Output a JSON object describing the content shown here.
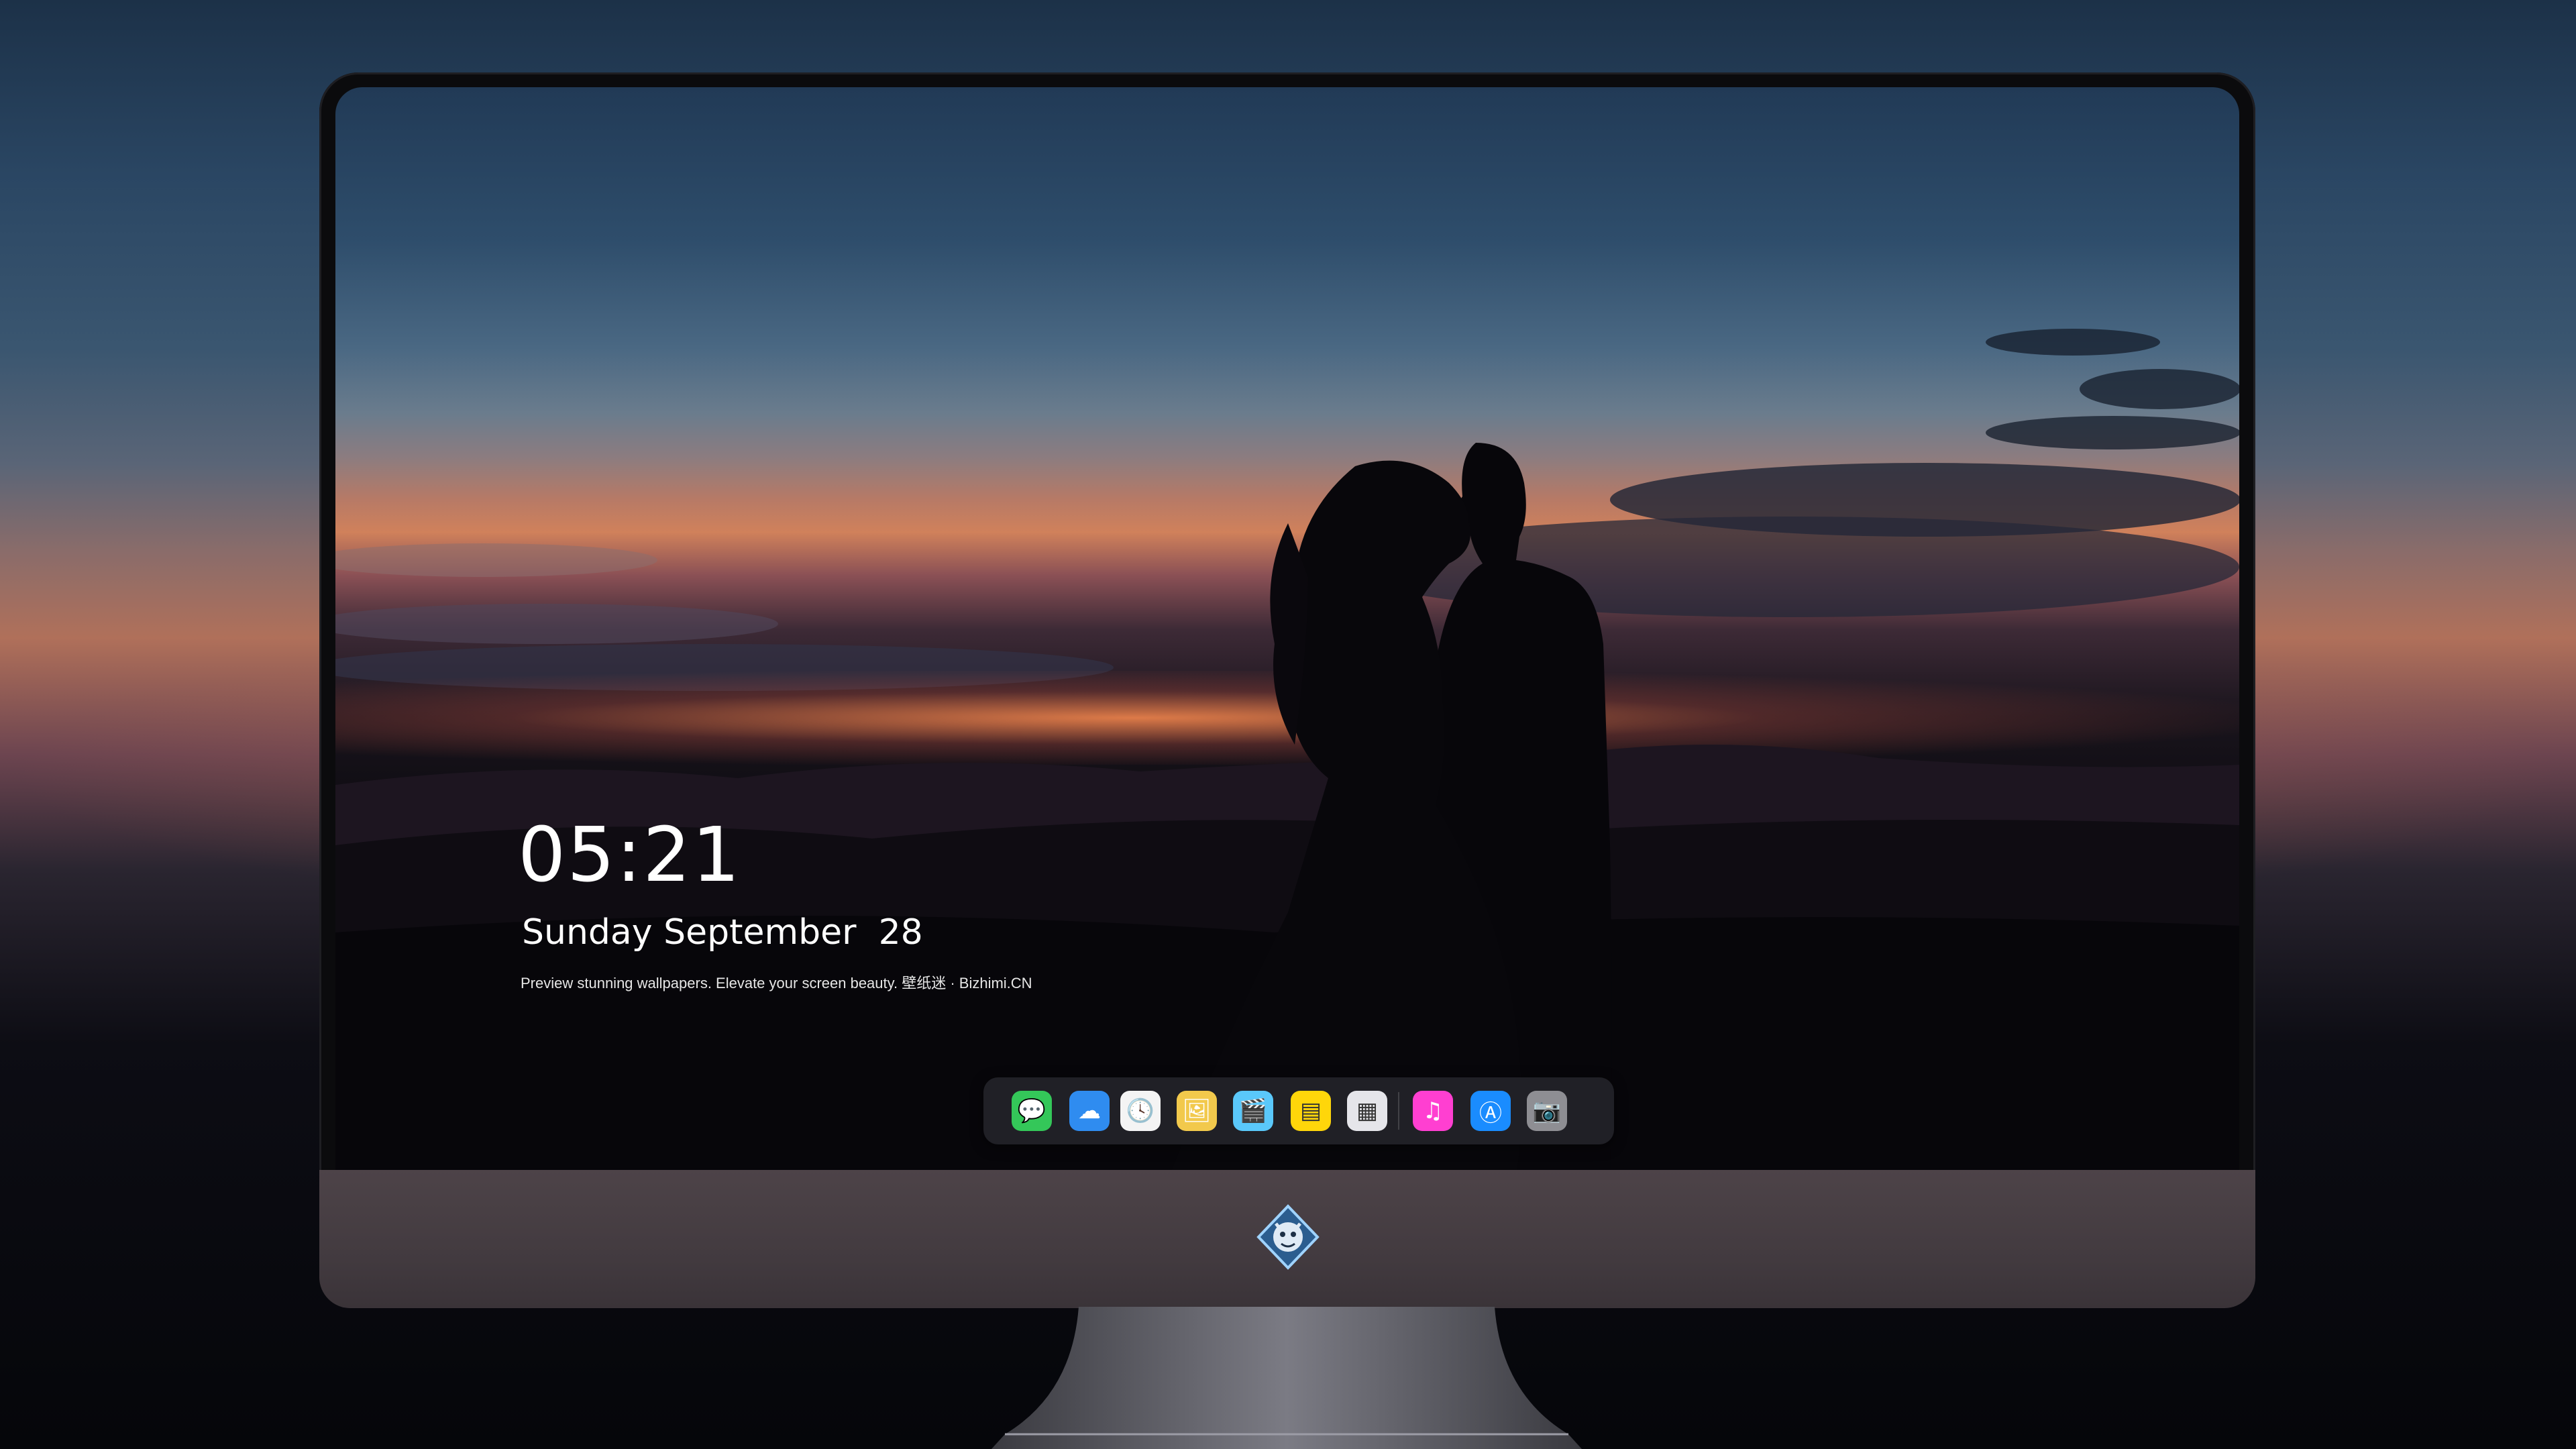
{
  "lockscreen": {
    "time": "05:21",
    "date": "Sunday September  28",
    "tagline": "Preview stunning wallpapers. Elevate your screen beauty. 壁纸迷 · Bizhimi.CN"
  },
  "dock": {
    "apps": [
      {
        "name": "messages-icon",
        "color": "#34c759",
        "glyph": "💬"
      },
      {
        "name": "weather-icon",
        "color": "#2f8cf0",
        "glyph": "☁"
      },
      {
        "name": "clock-icon",
        "color": "#f4f4f4",
        "glyph": "🕓"
      },
      {
        "name": "preview-icon",
        "color": "#f2c94c",
        "glyph": "🖼"
      },
      {
        "name": "final-cut-icon",
        "color": "#5ac8fa",
        "glyph": "🎬"
      },
      {
        "name": "notes-icon",
        "color": "#ffd60a",
        "glyph": "▤"
      },
      {
        "name": "photo-booth-icon",
        "color": "#e5e5ea",
        "glyph": "▦"
      },
      {
        "name": "itunes-icon",
        "color": "#ff3fd1",
        "glyph": "♫"
      },
      {
        "name": "app-store-icon",
        "color": "#1a8cff",
        "glyph": "Ⓐ"
      },
      {
        "name": "camera-icon",
        "color": "#8e8e93",
        "glyph": "📷"
      }
    ]
  },
  "colors": {
    "accent": "#ffffff",
    "sky_top": "#213a56",
    "sunset": "#d0815b"
  }
}
